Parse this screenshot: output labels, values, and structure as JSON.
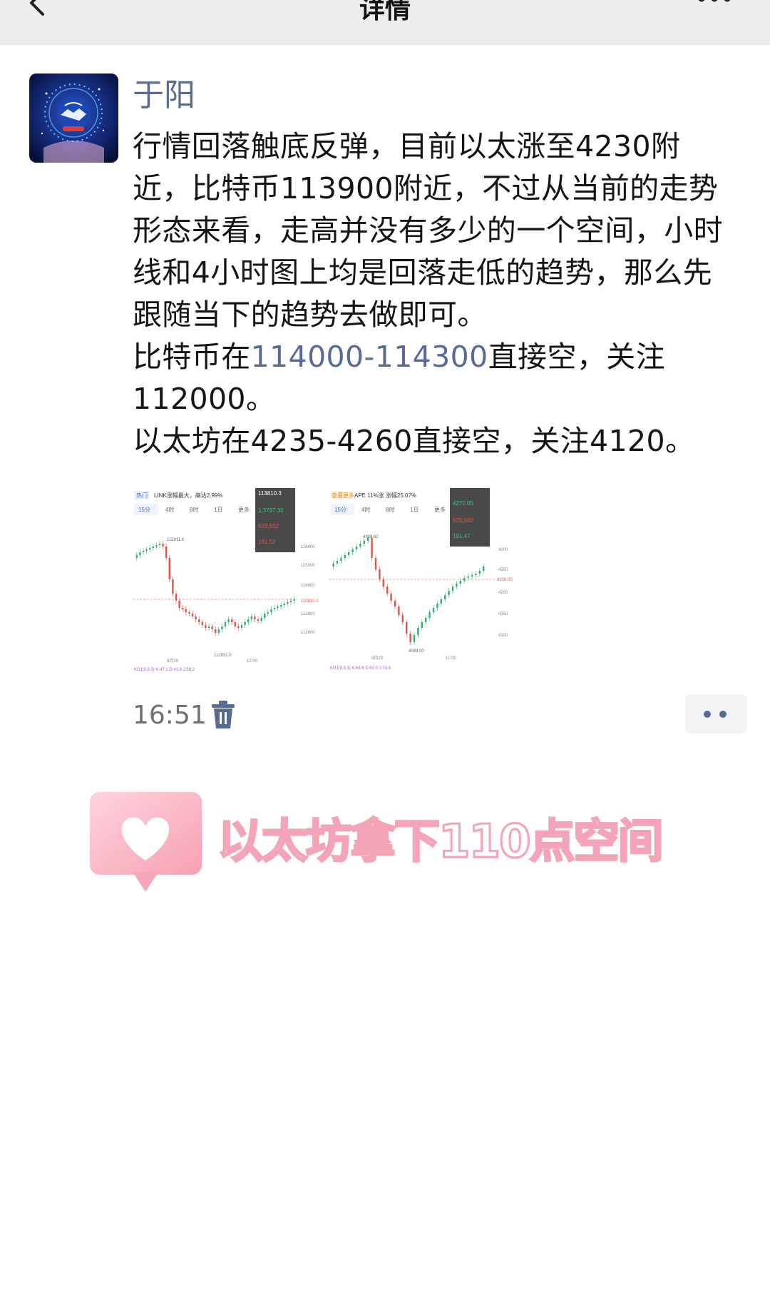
{
  "nav": {
    "title": "详情",
    "back_icon": "chevron-left-icon",
    "more_icon": "ellipsis-icon"
  },
  "post": {
    "author": "于阳",
    "avatar_icon": "handshake-logo-icon",
    "lines": [
      "行情回落触底反弹，目前以太涨至4230附近，比特币113900附近，不过从当前的走势形态来看，走高并没有多少的一个空间，小时线和4小时图上均是回落走低的趋势，那么先跟随当下的趋势去做即可。"
    ],
    "btc_prefix": "比特币在",
    "btc_range": "114000-114300",
    "btc_suffix": "直接空，关注112000。",
    "eth_line": "以太坊在4235-4260直接空，关注4120。",
    "time": "16:51",
    "delete_icon": "trash-icon",
    "comment_icon": "more-dots-icon"
  },
  "thumbnails": [
    {
      "tabs_label": "热门",
      "headline": "LINK涨幅最大，高达2.99%",
      "intervals": [
        "15分",
        "4时",
        "8时",
        "1日",
        "更多"
      ],
      "price_top": "115911.6",
      "price_low": "112931.0",
      "panel_price": "113810.3",
      "panel_vals": [
        "1,3797.30",
        "633,932",
        "181,52"
      ],
      "axis": [
        "116000",
        "115000",
        "114000",
        "113810.0",
        "113000",
        "112000"
      ],
      "date": "8月29",
      "time_label": "12:00",
      "footer": "KDJ(9,3,3) K:47.1 D:41.6 J:58.2"
    },
    {
      "tabs_label": "查看更多",
      "headline": "APE 11%涨 涨幅25.07%",
      "intervals": [
        "15分",
        "4时",
        "8时",
        "1日",
        "更多"
      ],
      "price_top": "4328.62",
      "price_low": "4099.00",
      "panel_price": "4270.05",
      "panel_vals": [
        "633,932",
        "181.47"
      ],
      "axis": [
        "4300",
        "4250",
        "4230.05",
        "4200",
        "4150",
        "4100"
      ],
      "date": "8月29",
      "time_label": "12:00",
      "footer": "KDJ(9,3,3) K:64.6 D:60.0 J:74.8"
    }
  ],
  "sticker": {
    "icon": "heart-bubble-icon",
    "caption": "以太坊拿下110点空间"
  }
}
